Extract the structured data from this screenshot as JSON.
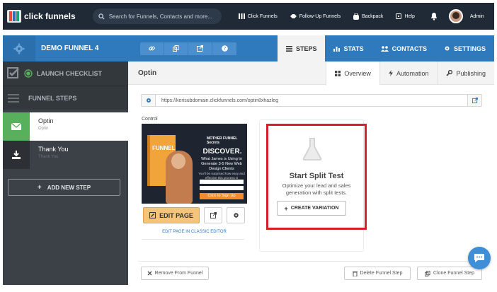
{
  "app": {
    "logo_text": "click funnels",
    "search_placeholder": "Search for Funnels, Contacts and more...",
    "nav_links": [
      "Click Funnels",
      "Follow-Up Funnels",
      "Backpack",
      "Help"
    ],
    "user_label": "Admin"
  },
  "funnel": {
    "title": "DEMO FUNNEL 4",
    "tabs": [
      "STEPS",
      "STATS",
      "CONTACTS",
      "SETTINGS"
    ],
    "active_tab": "STEPS"
  },
  "sidebar": {
    "launch_checklist": "LAUNCH CHECKLIST",
    "funnel_steps": "FUNNEL STEPS",
    "steps": [
      {
        "name": "Optin",
        "sub": "Optin"
      },
      {
        "name": "Thank You",
        "sub": "Thank You"
      }
    ],
    "add_step_label": "ADD NEW STEP"
  },
  "step_page": {
    "title": "Optin",
    "subtabs": [
      "Overview",
      "Automation",
      "Publishing"
    ],
    "active_subtab": "Overview",
    "url": "https://kerisubdomain.clickfunnels.com/optin8xhazleg",
    "control_label": "Control",
    "thumbnail": {
      "brand": "MOTHER FUNNEL Secrets",
      "headline": "DISCOVER.",
      "subtext": "What James is Using to Generate 3-5 New Web Design Clients",
      "fine": "You'll be surprised how easy and effective this process is",
      "button": "Click to Sign Up"
    },
    "edit_label": "EDIT PAGE",
    "classic_editor_link": "EDIT PAGE IN CLASSIC EDITOR",
    "split": {
      "title": "Start Split Test",
      "description": "Optimize your lead and sales generation with split tests.",
      "button": "CREATE VARIATION"
    },
    "footer_buttons": {
      "remove": "Remove From Funnel",
      "delete": "Delete Funnel Step",
      "clone": "Clone Funnel Step"
    }
  },
  "colors": {
    "topnav": "#1f2a36",
    "funnel_bar": "#2f79bd",
    "sidebar": "#3c4147",
    "active_step": "#58b05d",
    "highlight": "#d5202b",
    "edit_button": "#f3c47a"
  }
}
